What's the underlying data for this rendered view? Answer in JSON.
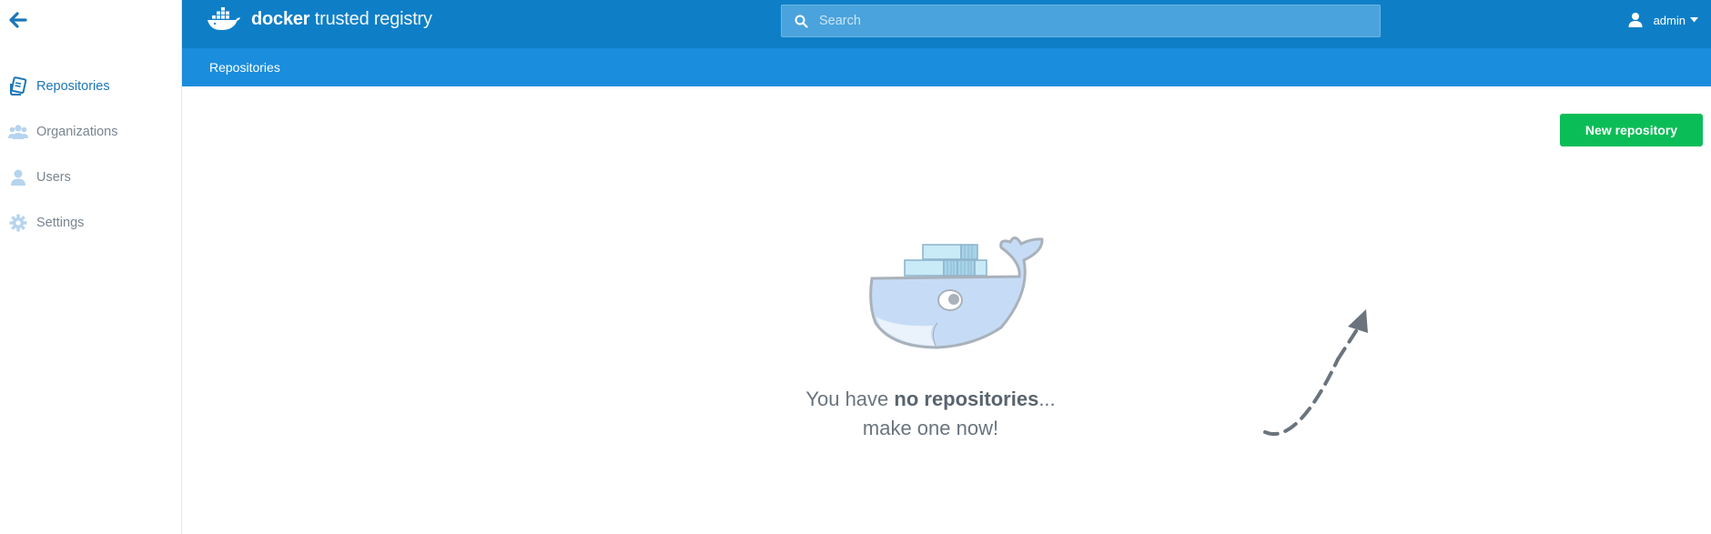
{
  "app": {
    "brand_bold": "docker",
    "brand_rest": " trusted registry"
  },
  "sidebar": {
    "back_icon": "arrow-left-icon",
    "items": [
      {
        "label": "Repositories",
        "icon": "book-stack-icon",
        "active": true
      },
      {
        "label": "Organizations",
        "icon": "users-group-icon",
        "active": false
      },
      {
        "label": "Users",
        "icon": "user-icon",
        "active": false
      },
      {
        "label": "Settings",
        "icon": "gear-icon",
        "active": false
      }
    ]
  },
  "search": {
    "placeholder": "Search",
    "value": ""
  },
  "user_menu": {
    "username": "admin",
    "icon": "user-icon"
  },
  "breadcrumb": {
    "current": "Repositories"
  },
  "main": {
    "new_button_label": "New repository",
    "empty_prefix": "You have ",
    "empty_bold": "no repositories",
    "empty_suffix": "...",
    "empty_line2": "make one now!"
  },
  "colors": {
    "topbar": "#0e7fc7",
    "subbar": "#1b8ddd",
    "accent": "#1b77b8",
    "success": "#0bbd57"
  }
}
